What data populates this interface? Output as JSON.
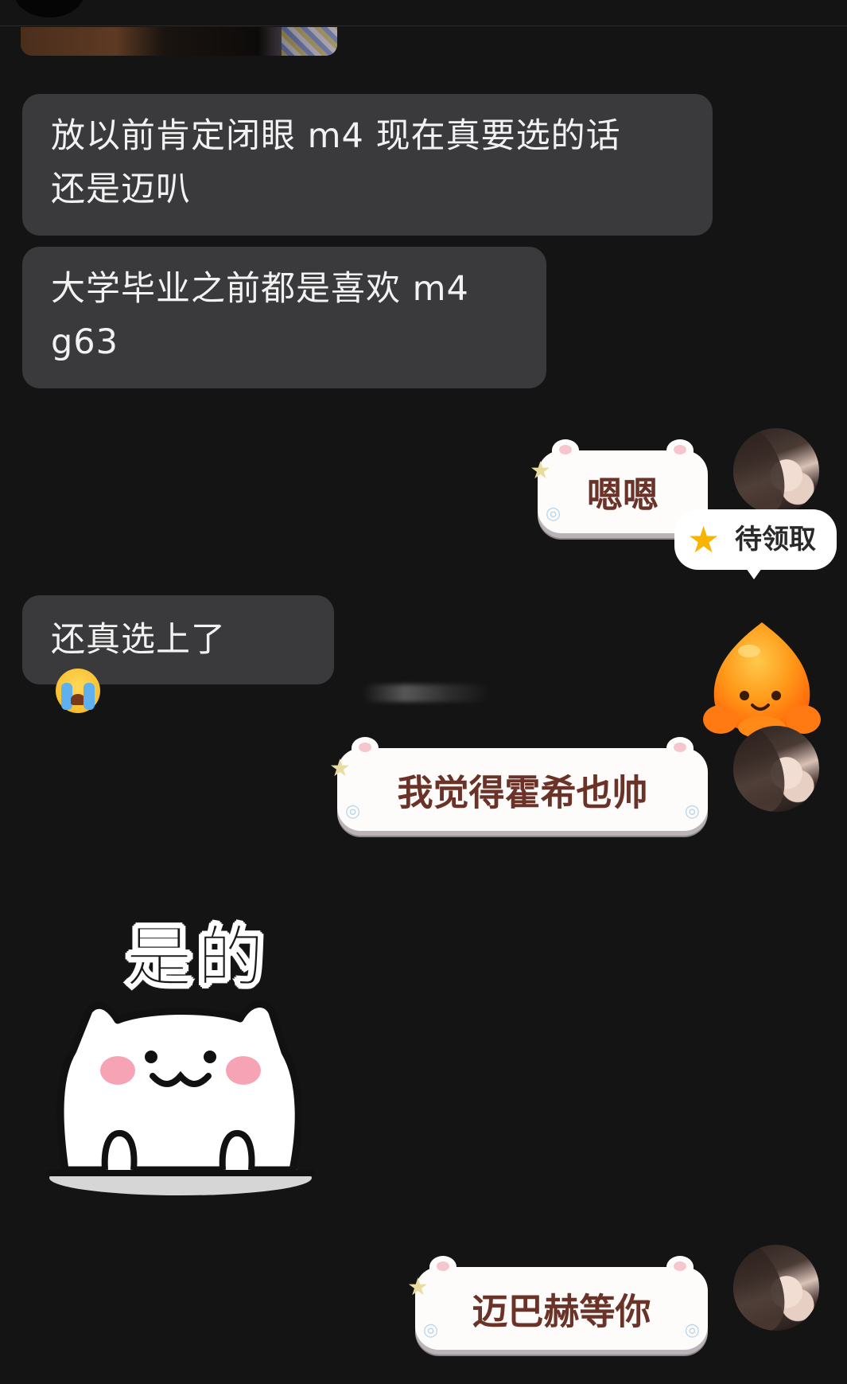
{
  "messages": {
    "m1": {
      "line1": "放以前肯定闭眼 m4 现在真要选的话",
      "line2": "还是迈叭"
    },
    "m2": {
      "line1": "大学毕业之前都是喜欢 m4",
      "line2": "g63"
    },
    "m3": "嗯嗯",
    "m4": "还真选上了",
    "m5": "我觉得霍希也帅",
    "m6_sticker_caption": "是的",
    "m7": "迈巴赫等你"
  },
  "badge": {
    "label": "待领取"
  },
  "colors": {
    "background": "#141414",
    "incoming_bubble": "#3a3a3c",
    "incoming_text": "#f2f2f2",
    "outgoing_bubble": "#fdfcfb",
    "outgoing_text": "#6b3228",
    "badge_star": "#f7b500"
  },
  "icons": {
    "crying_emoji": "loudly-crying-face",
    "badge_icon": "star",
    "blob_mascot": "orange-blob-mascot"
  }
}
